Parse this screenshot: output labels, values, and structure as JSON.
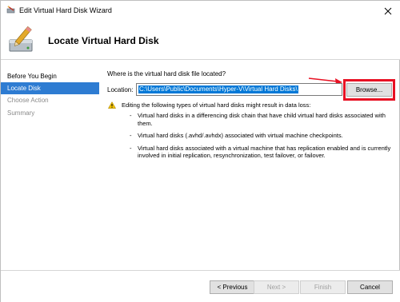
{
  "window": {
    "title": "Edit Virtual Hard Disk Wizard"
  },
  "header": {
    "title": "Locate Virtual Hard Disk"
  },
  "nav": {
    "items": [
      {
        "label": "Before You Begin",
        "state": "normal"
      },
      {
        "label": "Locate Disk",
        "state": "selected"
      },
      {
        "label": "Choose Action",
        "state": "disabled"
      },
      {
        "label": "Summary",
        "state": "disabled"
      }
    ]
  },
  "content": {
    "question": "Where is the virtual hard disk file located?",
    "location_label": "Location:",
    "location_value": "C:\\Users\\Public\\Documents\\Hyper-V\\Virtual Hard Disks\\",
    "browse_label": "Browse...",
    "warning": "Editing the following types of virtual hard disks might result in data loss:",
    "bullets": [
      "Virtual hard disks in a differencing disk chain that have child virtual hard disks associated with them.",
      "Virtual hard disks (.avhd/.avhdx) associated with virtual machine checkpoints.",
      "Virtual hard disks associated with a virtual machine that has replication enabled and is currently involved in initial replication, resynchronization, test failover, or failover."
    ]
  },
  "footer": {
    "previous": "< Previous",
    "next": "Next >",
    "finish": "Finish",
    "cancel": "Cancel"
  },
  "colors": {
    "selected_nav": "#2e7cd2",
    "annotation_red": "#e81123",
    "selection_blue": "#0078d7"
  }
}
